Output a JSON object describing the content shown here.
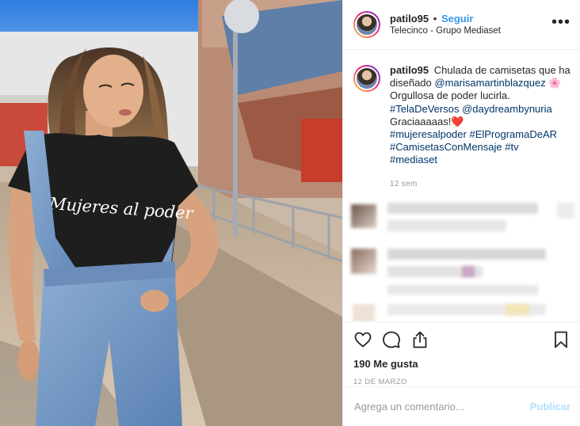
{
  "post": {
    "username": "patilo95",
    "follow_label": "Seguir",
    "separator": "•",
    "location": "Telecinco - Grupo Mediaset",
    "more_icon": "more-horizontal-icon",
    "photo_shirt_text": "Mujeres al poder"
  },
  "caption": {
    "username": "patilo95",
    "text_1": "Chulada de camisetas que ha diseñado ",
    "mention_1": "@marisamartinblazquez",
    "flower": "🌸",
    "text_2": "Orgullosa de poder lucirla.",
    "hashtag_1": "#TelaDeVersos",
    "mention_2": "@daydreambynuria",
    "text_3": "Graciaaaaas!",
    "heart": "❤️",
    "hashtag_2": "#mujeresalpoder",
    "hashtag_3": "#ElProgramaDeAR",
    "hashtag_4": "#CamisetasConMensaje",
    "hashtag_5": "#tv",
    "hashtag_6": "#mediaset",
    "time": "12 sem"
  },
  "actions": {
    "like_icon": "heart-outline-icon",
    "comment_icon": "comment-bubble-icon",
    "share_icon": "share-icon",
    "save_icon": "bookmark-icon",
    "likes": "190 Me gusta",
    "date": "12 DE MARZO"
  },
  "comment_box": {
    "placeholder": "Agrega un comentario...",
    "publish_label": "Publicar"
  },
  "colors": {
    "link": "#003569",
    "follow": "#3897f0",
    "publish_disabled": "#b2dffc",
    "muted": "#999999",
    "border": "#efefef"
  }
}
